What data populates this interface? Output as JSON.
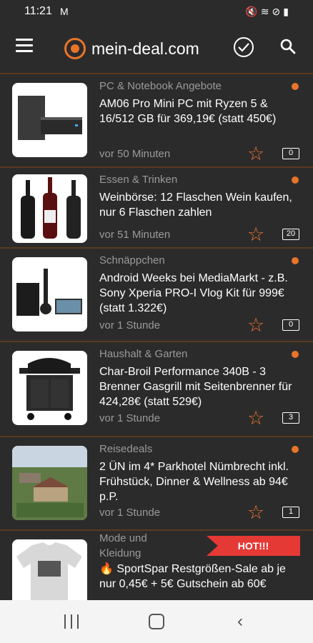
{
  "status_bar": {
    "time": "11:21",
    "mail_glyph": "M",
    "right_icons": [
      "mute-icon",
      "wifi-icon",
      "blocked-icon",
      "battery-icon"
    ]
  },
  "app_bar": {
    "logo_text": "mein-deal.com"
  },
  "colors": {
    "accent": "#e8742a",
    "hot": "#e53935",
    "background": "#2b2b2b"
  },
  "deals": [
    {
      "category": "PC & Notebook Angebote",
      "title": "AM06 Pro Mini PC mit Ryzen 5 & 16/512 GB für 369,19€ (statt 450€)",
      "time": "vor 50 Minuten",
      "comments": "0",
      "has_dot": true
    },
    {
      "category": "Essen & Trinken",
      "title": "Weinbörse: 12 Flaschen Wein kaufen, nur 6 Flaschen zahlen",
      "time": "vor 51 Minuten",
      "comments": "20",
      "has_dot": true
    },
    {
      "category": "Schnäppchen",
      "title": "Android Weeks bei MediaMarkt - z.B. Sony Xperia PRO-I Vlog Kit für 999€ (statt 1.322€)",
      "time": "vor 1 Stunde",
      "comments": "0",
      "has_dot": true
    },
    {
      "category": "Haushalt & Garten",
      "title": "Char-Broil Performance 340B - 3 Brenner Gasgrill mit Seitenbrenner für 424,28€ (statt 529€)",
      "time": "vor 1 Stunde",
      "comments": "3",
      "has_dot": true
    },
    {
      "category": "Reisedeals",
      "title": "2 ÜN im 4* Parkhotel Nümbrecht inkl. Frühstück, Dinner & Wellness ab 94€ p.P.",
      "time": "vor 1 Stunde",
      "comments": "1",
      "has_dot": true
    },
    {
      "category": "Mode und Kleidung",
      "title": "🔥 SportSpar Restgrößen-Sale ab je nur 0,45€ + 5€ Gutschein ab 60€",
      "badge": "HOT!!!",
      "has_dot": false
    }
  ]
}
